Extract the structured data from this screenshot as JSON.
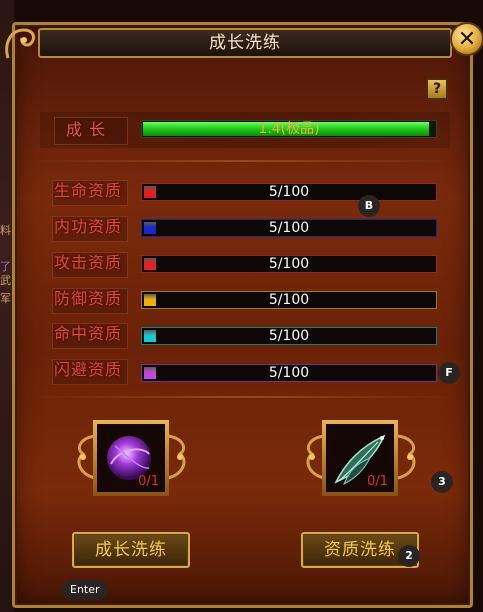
{
  "window": {
    "title": "成长洗练",
    "close_glyph": "✕",
    "help_glyph": "?"
  },
  "growth": {
    "label": "成 长",
    "value_text": "1.4(极品)",
    "fill_fraction": 0.98
  },
  "stats": [
    {
      "label": "生命资质",
      "value": "5/100",
      "color": "#e02020",
      "border": "#8a2a22"
    },
    {
      "label": "内功资质",
      "value": "5/100",
      "color": "#1a28c8",
      "border": "#1a2a8a"
    },
    {
      "label": "攻击资质",
      "value": "5/100",
      "color": "#e02424",
      "border": "#8a2a22"
    },
    {
      "label": "防御资质",
      "value": "5/100",
      "color": "#e8b010",
      "border": "#a07a22"
    },
    {
      "label": "命中资质",
      "value": "5/100",
      "color": "#1ac8d4",
      "border": "#1a7a7a"
    },
    {
      "label": "闪避资质",
      "value": "5/100",
      "color": "#c04ad8",
      "border": "#7a2a8a"
    }
  ],
  "items": [
    {
      "icon": "purple-orb-icon",
      "count": "0/1"
    },
    {
      "icon": "jade-leaf-icon",
      "count": "0/1"
    }
  ],
  "buttons": {
    "growth_refine": "成长洗练",
    "aptitude_refine": "资质洗练"
  },
  "hotkeys": {
    "b": "B",
    "f": "F",
    "three": "3",
    "two": "2",
    "enter": "Enter"
  },
  "left_edge_text": [
    "料",
    "了",
    "武",
    "军"
  ]
}
